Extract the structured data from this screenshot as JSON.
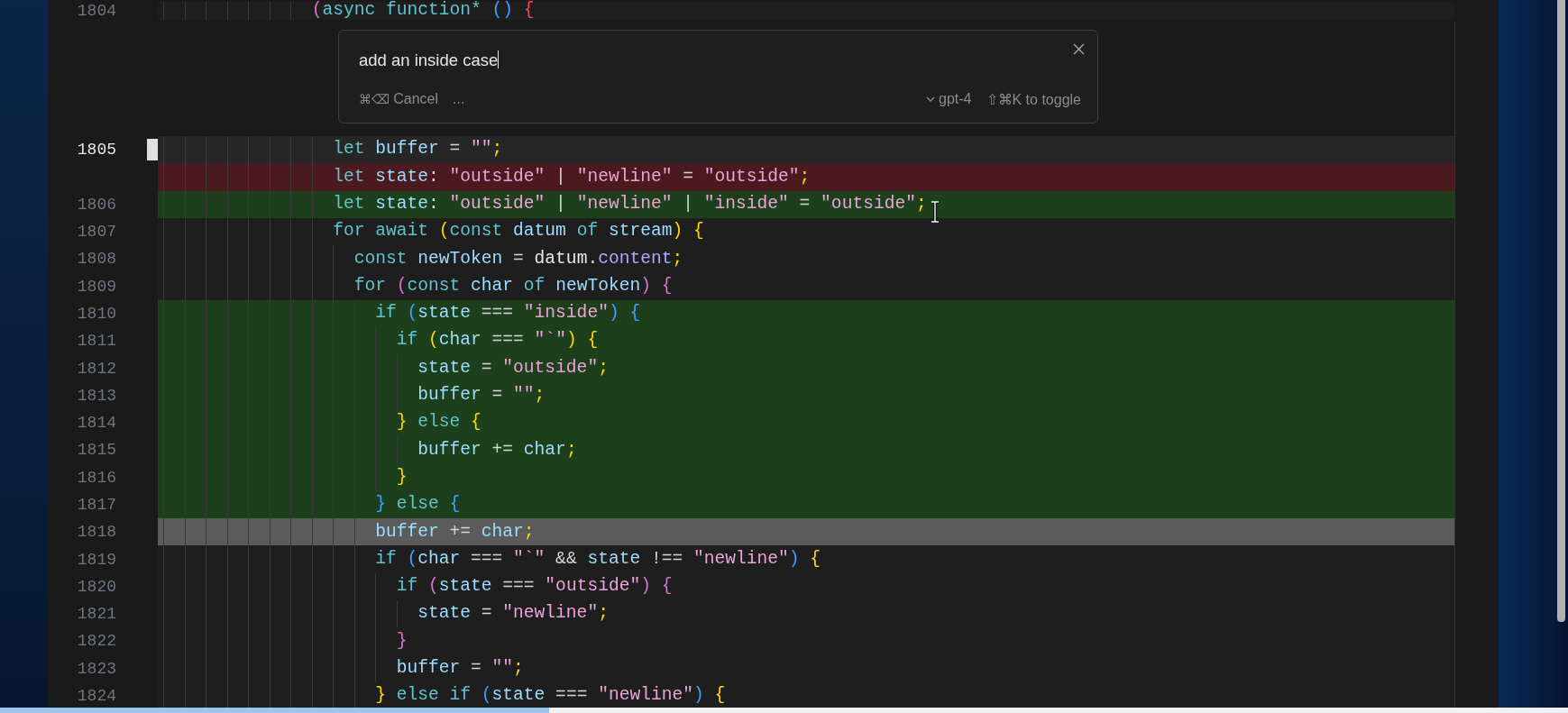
{
  "prompt": {
    "value": "add an inside case",
    "cancel_shortcut": "⌘⌫",
    "cancel_label": "Cancel",
    "more": "...",
    "model": "gpt-4",
    "toggle_hint": "⇧⌘K to toggle"
  },
  "lines": [
    {
      "number": "1804",
      "kind": "normal",
      "tokens": [
        {
          "kind": "b2",
          "text": "              ("
        },
        {
          "kind": "kw",
          "text": "async function* "
        },
        {
          "kind": "b3",
          "text": "() "
        },
        {
          "kind": "b4",
          "text": "{"
        }
      ]
    },
    {
      "number": "1805",
      "kind": "current",
      "tokens": [
        {
          "kind": "kw",
          "text": "                let "
        },
        {
          "kind": "var",
          "text": "buffer"
        },
        {
          "kind": "op",
          "text": " = "
        },
        {
          "kind": "str",
          "text": "\"\""
        },
        {
          "kind": "semi",
          "text": ";"
        }
      ]
    },
    {
      "kind": "removed",
      "tokens": [
        {
          "kind": "kw",
          "text": "                let "
        },
        {
          "kind": "var",
          "text": "state"
        },
        {
          "kind": "op",
          "text": ": "
        },
        {
          "kind": "str",
          "text": "\"outside\""
        },
        {
          "kind": "op",
          "text": " | "
        },
        {
          "kind": "str",
          "text": "\"newline\""
        },
        {
          "kind": "op",
          "text": " = "
        },
        {
          "kind": "str",
          "text": "\"outside\""
        },
        {
          "kind": "semi",
          "text": ";"
        }
      ]
    },
    {
      "number": "1806",
      "kind": "added",
      "tokens": [
        {
          "kind": "kw",
          "text": "                let "
        },
        {
          "kind": "var",
          "text": "state"
        },
        {
          "kind": "op",
          "text": ": "
        },
        {
          "kind": "str",
          "text": "\"outside\""
        },
        {
          "kind": "op",
          "text": " | "
        },
        {
          "kind": "str",
          "text": "\"newline\""
        },
        {
          "kind": "op",
          "text": " | "
        },
        {
          "kind": "str",
          "text": "\"inside\""
        },
        {
          "kind": "op",
          "text": " = "
        },
        {
          "kind": "str",
          "text": "\"outside\""
        },
        {
          "kind": "semi",
          "text": ";"
        }
      ]
    },
    {
      "number": "1807",
      "kind": "normal",
      "tokens": [
        {
          "kind": "kw",
          "text": "                for await "
        },
        {
          "kind": "b1",
          "text": "("
        },
        {
          "kind": "kw",
          "text": "const "
        },
        {
          "kind": "var",
          "text": "datum"
        },
        {
          "kind": "kw",
          "text": " of "
        },
        {
          "kind": "var",
          "text": "stream"
        },
        {
          "kind": "b1",
          "text": ") {"
        }
      ]
    },
    {
      "number": "1808",
      "kind": "normal",
      "tokens": [
        {
          "kind": "kw",
          "text": "                  const "
        },
        {
          "kind": "var",
          "text": "newToken"
        },
        {
          "kind": "op",
          "text": " = "
        },
        {
          "kind": "plain",
          "text": "datum"
        },
        {
          "kind": "op",
          "text": "."
        },
        {
          "kind": "prop",
          "text": "content"
        },
        {
          "kind": "semi",
          "text": ";"
        }
      ]
    },
    {
      "number": "1809",
      "kind": "normal",
      "tokens": [
        {
          "kind": "kw",
          "text": "                  for "
        },
        {
          "kind": "b2",
          "text": "("
        },
        {
          "kind": "kw",
          "text": "const "
        },
        {
          "kind": "var",
          "text": "char"
        },
        {
          "kind": "kw",
          "text": " of "
        },
        {
          "kind": "var",
          "text": "newToken"
        },
        {
          "kind": "b2",
          "text": ") {"
        }
      ]
    },
    {
      "number": "1810",
      "kind": "added",
      "tokens": [
        {
          "kind": "kw",
          "text": "                    if "
        },
        {
          "kind": "b3",
          "text": "("
        },
        {
          "kind": "var",
          "text": "state"
        },
        {
          "kind": "op",
          "text": " === "
        },
        {
          "kind": "str",
          "text": "\"inside\""
        },
        {
          "kind": "b3",
          "text": ") {"
        }
      ]
    },
    {
      "number": "1811",
      "kind": "added",
      "tokens": [
        {
          "kind": "kw",
          "text": "                      if "
        },
        {
          "kind": "b1",
          "text": "("
        },
        {
          "kind": "var",
          "text": "char"
        },
        {
          "kind": "op",
          "text": " === "
        },
        {
          "kind": "str",
          "text": "\"`\""
        },
        {
          "kind": "b1",
          "text": ") {"
        }
      ]
    },
    {
      "number": "1812",
      "kind": "added",
      "tokens": [
        {
          "kind": "var",
          "text": "                        state"
        },
        {
          "kind": "op",
          "text": " = "
        },
        {
          "kind": "str",
          "text": "\"outside\""
        },
        {
          "kind": "semi",
          "text": ";"
        }
      ]
    },
    {
      "number": "1813",
      "kind": "added",
      "tokens": [
        {
          "kind": "var",
          "text": "                        buffer"
        },
        {
          "kind": "op",
          "text": " = "
        },
        {
          "kind": "str",
          "text": "\"\""
        },
        {
          "kind": "semi",
          "text": ";"
        }
      ]
    },
    {
      "number": "1814",
      "kind": "added",
      "tokens": [
        {
          "kind": "b1",
          "text": "                      } "
        },
        {
          "kind": "kw",
          "text": "else "
        },
        {
          "kind": "b1",
          "text": "{"
        }
      ]
    },
    {
      "number": "1815",
      "kind": "added",
      "tokens": [
        {
          "kind": "var",
          "text": "                        buffer"
        },
        {
          "kind": "op",
          "text": " += "
        },
        {
          "kind": "var",
          "text": "char"
        },
        {
          "kind": "semi",
          "text": ";"
        }
      ]
    },
    {
      "number": "1816",
      "kind": "added",
      "tokens": [
        {
          "kind": "b1",
          "text": "                      }"
        }
      ]
    },
    {
      "number": "1817",
      "kind": "added",
      "tokens": [
        {
          "kind": "b3",
          "text": "                    } "
        },
        {
          "kind": "kw",
          "text": "else "
        },
        {
          "kind": "b3",
          "text": "{"
        }
      ]
    },
    {
      "number": "1818",
      "kind": "selected",
      "tokens": [
        {
          "kind": "var",
          "text": "                    buffer"
        },
        {
          "kind": "op",
          "text": " += "
        },
        {
          "kind": "var",
          "text": "char"
        },
        {
          "kind": "semi",
          "text": ";"
        }
      ]
    },
    {
      "number": "1819",
      "kind": "normal",
      "tokens": [
        {
          "kind": "kw",
          "text": "                    if "
        },
        {
          "kind": "b3",
          "text": "("
        },
        {
          "kind": "var",
          "text": "char"
        },
        {
          "kind": "op",
          "text": " === "
        },
        {
          "kind": "str",
          "text": "\"`\""
        },
        {
          "kind": "op",
          "text": " && "
        },
        {
          "kind": "var",
          "text": "state"
        },
        {
          "kind": "op",
          "text": " !== "
        },
        {
          "kind": "str",
          "text": "\"newline\""
        },
        {
          "kind": "b3",
          "text": ") "
        },
        {
          "kind": "b1",
          "text": "{"
        }
      ]
    },
    {
      "number": "1820",
      "kind": "normal",
      "tokens": [
        {
          "kind": "kw",
          "text": "                      if "
        },
        {
          "kind": "b2",
          "text": "("
        },
        {
          "kind": "var",
          "text": "state"
        },
        {
          "kind": "op",
          "text": " === "
        },
        {
          "kind": "str",
          "text": "\"outside\""
        },
        {
          "kind": "b2",
          "text": ") {"
        }
      ]
    },
    {
      "number": "1821",
      "kind": "normal",
      "tokens": [
        {
          "kind": "var",
          "text": "                        state"
        },
        {
          "kind": "op",
          "text": " = "
        },
        {
          "kind": "str",
          "text": "\"newline\""
        },
        {
          "kind": "semi",
          "text": ";"
        }
      ]
    },
    {
      "number": "1822",
      "kind": "normal",
      "tokens": [
        {
          "kind": "b2",
          "text": "                      }"
        }
      ]
    },
    {
      "number": "1823",
      "kind": "normal",
      "tokens": [
        {
          "kind": "var",
          "text": "                      buffer"
        },
        {
          "kind": "op",
          "text": " = "
        },
        {
          "kind": "str",
          "text": "\"\""
        },
        {
          "kind": "semi",
          "text": ";"
        }
      ]
    },
    {
      "number": "1824",
      "kind": "normal",
      "tokens": [
        {
          "kind": "b1",
          "text": "                    } "
        },
        {
          "kind": "kw",
          "text": "else if "
        },
        {
          "kind": "b3",
          "text": "("
        },
        {
          "kind": "var",
          "text": "state"
        },
        {
          "kind": "op",
          "text": " === "
        },
        {
          "kind": "str",
          "text": "\"newline\""
        },
        {
          "kind": "b3",
          "text": ") "
        },
        {
          "kind": "b1",
          "text": "{"
        }
      ]
    }
  ],
  "video_progress": {
    "level": 0.35
  }
}
